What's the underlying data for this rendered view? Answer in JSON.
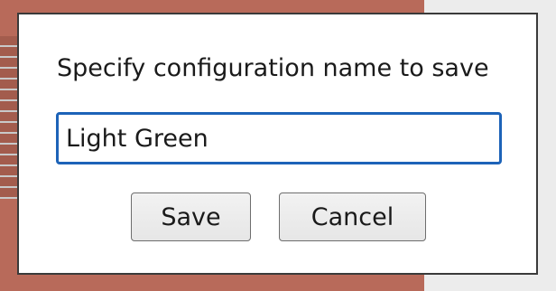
{
  "dialog": {
    "prompt": "Specify configuration name to save",
    "name_value": "Light Green",
    "save_label": "Save",
    "cancel_label": "Cancel"
  },
  "colors": {
    "input_border": "#1d63b8",
    "dialog_border": "#3a3a3a",
    "backdrop_accent": "#b86a5a"
  }
}
